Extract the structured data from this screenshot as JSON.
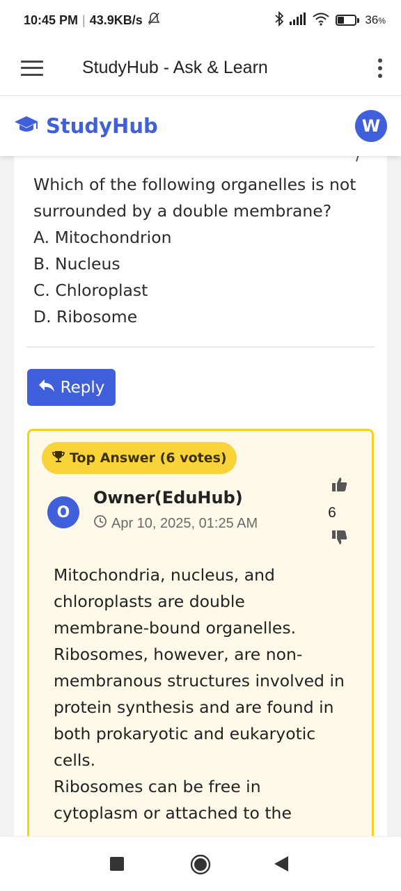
{
  "status_bar": {
    "time": "10:45 PM",
    "net_speed": "43.9KB/s",
    "battery": "36",
    "battery_unit": "%",
    "battery_level": 0.36
  },
  "app_bar": {
    "title": "StudyHub - Ask & Learn"
  },
  "site_header": {
    "brand": "StudyHub",
    "user_initial": "W",
    "accent_color": "#3f5fdb"
  },
  "question": {
    "text": "Which of the following organelles is not surrounded by a double membrane?",
    "options": [
      "A. Mitochondrion",
      "B. Nucleus",
      "C. Chloroplast",
      "D. Ribosome"
    ]
  },
  "reply_button": {
    "label": "Reply"
  },
  "top_answer": {
    "badge": "Top Answer (6 votes)",
    "author_initial": "O",
    "author": "Owner(EduHub)",
    "date": "Apr 10, 2025, 01:25 AM",
    "votes": "6",
    "body_lines": [
      "Mitochondria, nucleus, and",
      "chloroplasts are double",
      "membrane-bound organelles.",
      "Ribosomes, however, are non-",
      "membranous structures involved in",
      "protein synthesis and are found in",
      "both prokaryotic and eukaryotic",
      "cells.",
      "Ribosomes can be free in",
      "cytoplasm or attached to the"
    ],
    "border_color": "#f4cf1c",
    "badge_color": "#f9d33a"
  }
}
